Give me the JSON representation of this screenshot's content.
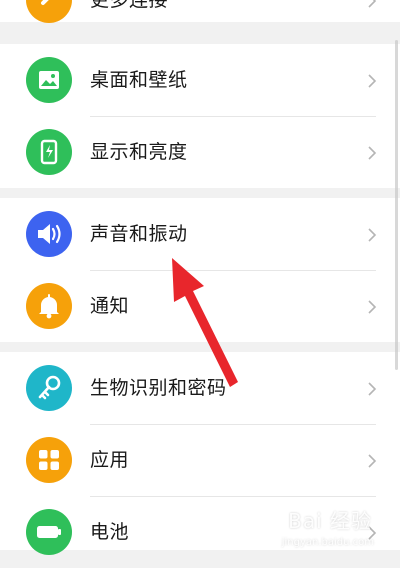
{
  "settings": {
    "items": [
      {
        "label": "更多连接",
        "icon": "link-icon",
        "color": "#f6a10a"
      },
      {
        "label": "桌面和壁纸",
        "icon": "wallpaper-icon",
        "color": "#2fbf5a"
      },
      {
        "label": "显示和亮度",
        "icon": "brightness-icon",
        "color": "#2fbf5a"
      },
      {
        "label": "声音和振动",
        "icon": "speaker-icon",
        "color": "#3d63f0"
      },
      {
        "label": "通知",
        "icon": "bell-icon",
        "color": "#f6a10a"
      },
      {
        "label": "生物识别和密码",
        "icon": "key-icon",
        "color": "#1fb6c9"
      },
      {
        "label": "应用",
        "icon": "apps-grid-icon",
        "color": "#f6a10a"
      },
      {
        "label": "电池",
        "icon": "battery-icon",
        "color": "#2fbf5a"
      }
    ]
  },
  "annotation": {
    "arrow_color": "#e8262c"
  },
  "watermark": {
    "text": "Bai 经验",
    "sub": "jingyan.baidu.com"
  }
}
